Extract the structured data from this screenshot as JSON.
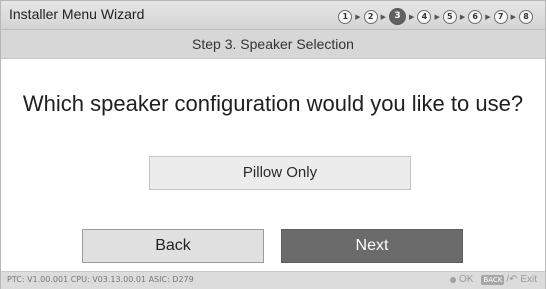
{
  "header": {
    "title": "Installer Menu Wizard",
    "steps": [
      "1",
      "2",
      "3",
      "4",
      "5",
      "6",
      "7",
      "8"
    ],
    "current_step": 3
  },
  "stepbar": {
    "label": "Step 3. Speaker Selection"
  },
  "main": {
    "question": "Which speaker configuration would you like to use?",
    "option": "Pillow Only"
  },
  "buttons": {
    "back": "Back",
    "next": "Next"
  },
  "footer": {
    "version": "PTC:  V1.00.001 CPU: V03.13.00.01 ASIC: D279",
    "ok": "OK",
    "back_key": "BACK",
    "exit": "/↶ Exit"
  },
  "colors": {
    "titlebar": "#d9d9d9",
    "stepbar": "#d7d7d7",
    "next_button": "#6b6b6b",
    "back_button": "#e0e0e0"
  }
}
